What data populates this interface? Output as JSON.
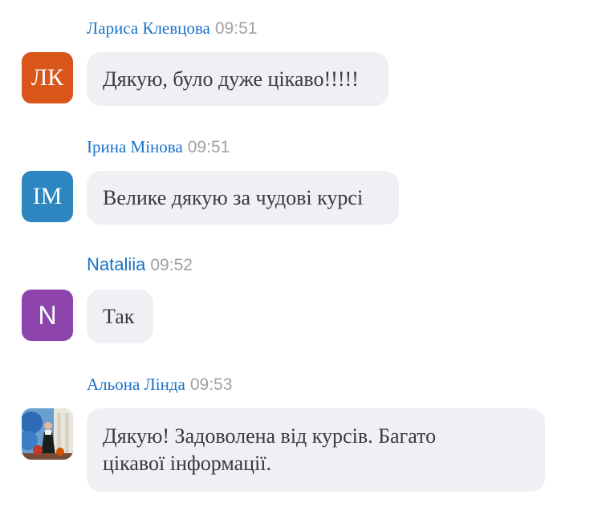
{
  "messages": [
    {
      "sender": "Лариса Клевцова",
      "time": "09:51",
      "avatar_initials": "ЛК",
      "avatar_color": "#d9561a",
      "text": "Дякую, було дуже цікаво!!!!!"
    },
    {
      "sender": "Ірина Мінова",
      "time": "09:51",
      "avatar_initials": "ІМ",
      "avatar_color": "#2e86c1",
      "text": "Велике дякую за чудові курсі"
    },
    {
      "sender": "Nataliia",
      "time": "09:52",
      "avatar_initials": "N",
      "avatar_color": "#8e44ad",
      "text": "Так"
    },
    {
      "sender": "Альона Лінда",
      "time": "09:53",
      "avatar_type": "photo",
      "text_line1": "Дякую! Задоволена від курсів. Багато",
      "text_line2": "цікавої інформації."
    }
  ],
  "colors": {
    "sender_name": "#1a73c8",
    "timestamp": "#a0a0a8",
    "bubble_bg": "#efeff4",
    "bubble_text": "#3a3a3c"
  }
}
